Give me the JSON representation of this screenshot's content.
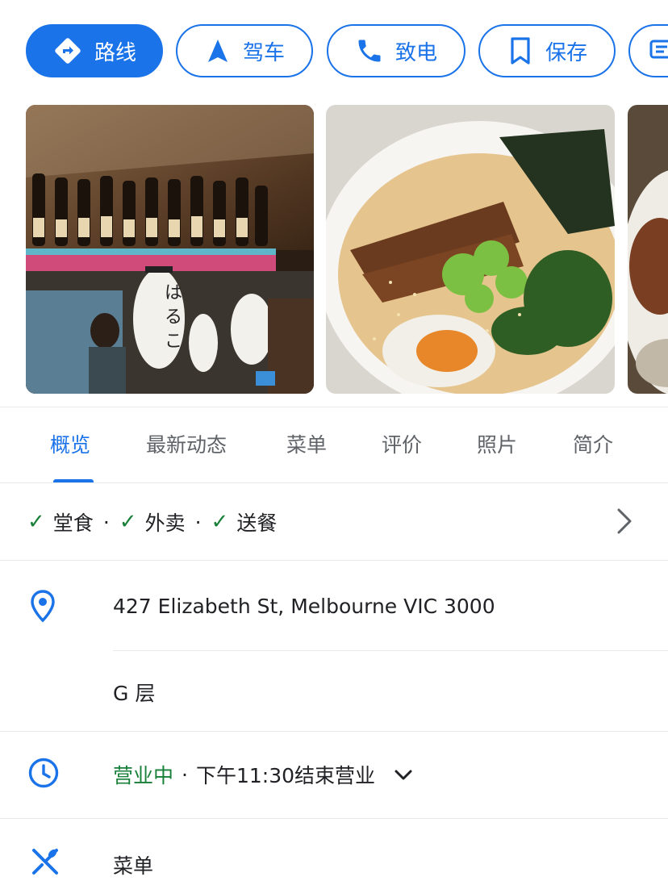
{
  "actions": {
    "directions_label": "路线",
    "drive_label": "驾车",
    "call_label": "致电",
    "save_label": "保存"
  },
  "tabs": [
    {
      "label": "概览"
    },
    {
      "label": "最新动态"
    },
    {
      "label": "菜单"
    },
    {
      "label": "评价"
    },
    {
      "label": "照片"
    },
    {
      "label": "简介"
    }
  ],
  "services": {
    "items": [
      "堂食",
      "外卖",
      "送餐"
    ],
    "separator": "·"
  },
  "address": {
    "line": "427 Elizabeth St, Melbourne VIC 3000",
    "floor": "G 层"
  },
  "hours": {
    "status": "营业中",
    "separator": "·",
    "closing": "下午11:30结束营业"
  },
  "menu": {
    "label": "菜单"
  },
  "colors": {
    "accent": "#1a73e8",
    "open_green": "#188038",
    "text": "#202124",
    "muted": "#5f6368"
  },
  "icons": {
    "directions": "directions-icon",
    "drive": "navigation-arrow-icon",
    "call": "phone-icon",
    "save": "bookmark-icon",
    "location": "location-pin-icon",
    "clock": "clock-icon",
    "menu": "fork-knife-icon"
  }
}
